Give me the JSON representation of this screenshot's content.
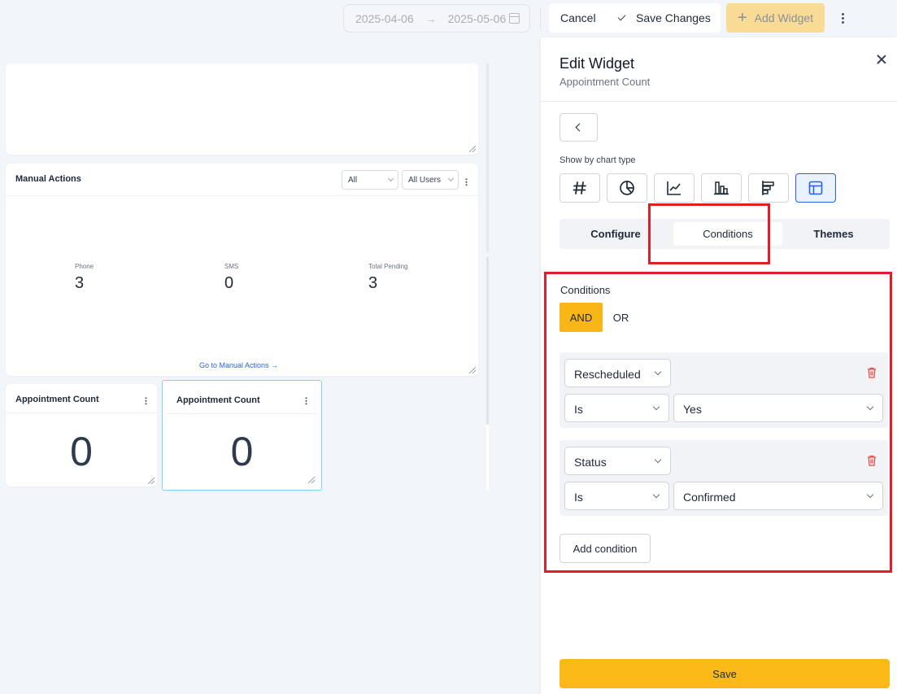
{
  "toolbar": {
    "date_start": "2025-04-06",
    "date_end": "2025-05-06",
    "cancel_label": "Cancel",
    "save_changes_label": "Save Changes",
    "add_widget_label": "Add Widget"
  },
  "dashboard": {
    "manual_actions": {
      "title": "Manual Actions",
      "filter_type": "All",
      "filter_users": "All Users",
      "stats": [
        {
          "label": "Phone",
          "value": "3"
        },
        {
          "label": "SMS",
          "value": "0"
        },
        {
          "label": "Total Pending",
          "value": "3"
        }
      ],
      "link": "Go to Manual Actions →"
    },
    "appointment_cards": [
      {
        "title": "Appointment Count",
        "value": "0"
      },
      {
        "title": "Appointment Count",
        "value": "0"
      }
    ]
  },
  "panel": {
    "title": "Edit Widget",
    "subtitle": "Appointment Count",
    "show_by_label": "Show by chart type",
    "chart_types": [
      "number-icon",
      "pie-chart-icon",
      "line-chart-icon",
      "bar-chart-icon",
      "horizontal-bar-chart-icon",
      "table-icon"
    ],
    "active_chart_type": "table-icon",
    "tabs": [
      "Configure",
      "Conditions",
      "Themes"
    ],
    "active_tab": "Conditions",
    "conditions_label": "Conditions",
    "logic_and": "AND",
    "logic_or": "OR",
    "active_logic": "AND",
    "conditions": [
      {
        "field": "Rescheduled",
        "operator": "Is",
        "value": "Yes"
      },
      {
        "field": "Status",
        "operator": "Is",
        "value": "Confirmed"
      }
    ],
    "add_condition_label": "Add condition",
    "save_label": "Save"
  },
  "colors": {
    "accent": "#fbb917",
    "active_chart_border": "#2563eb",
    "highlight": "#e11d2a",
    "link": "#2563eb",
    "delete": "#ef4444"
  }
}
